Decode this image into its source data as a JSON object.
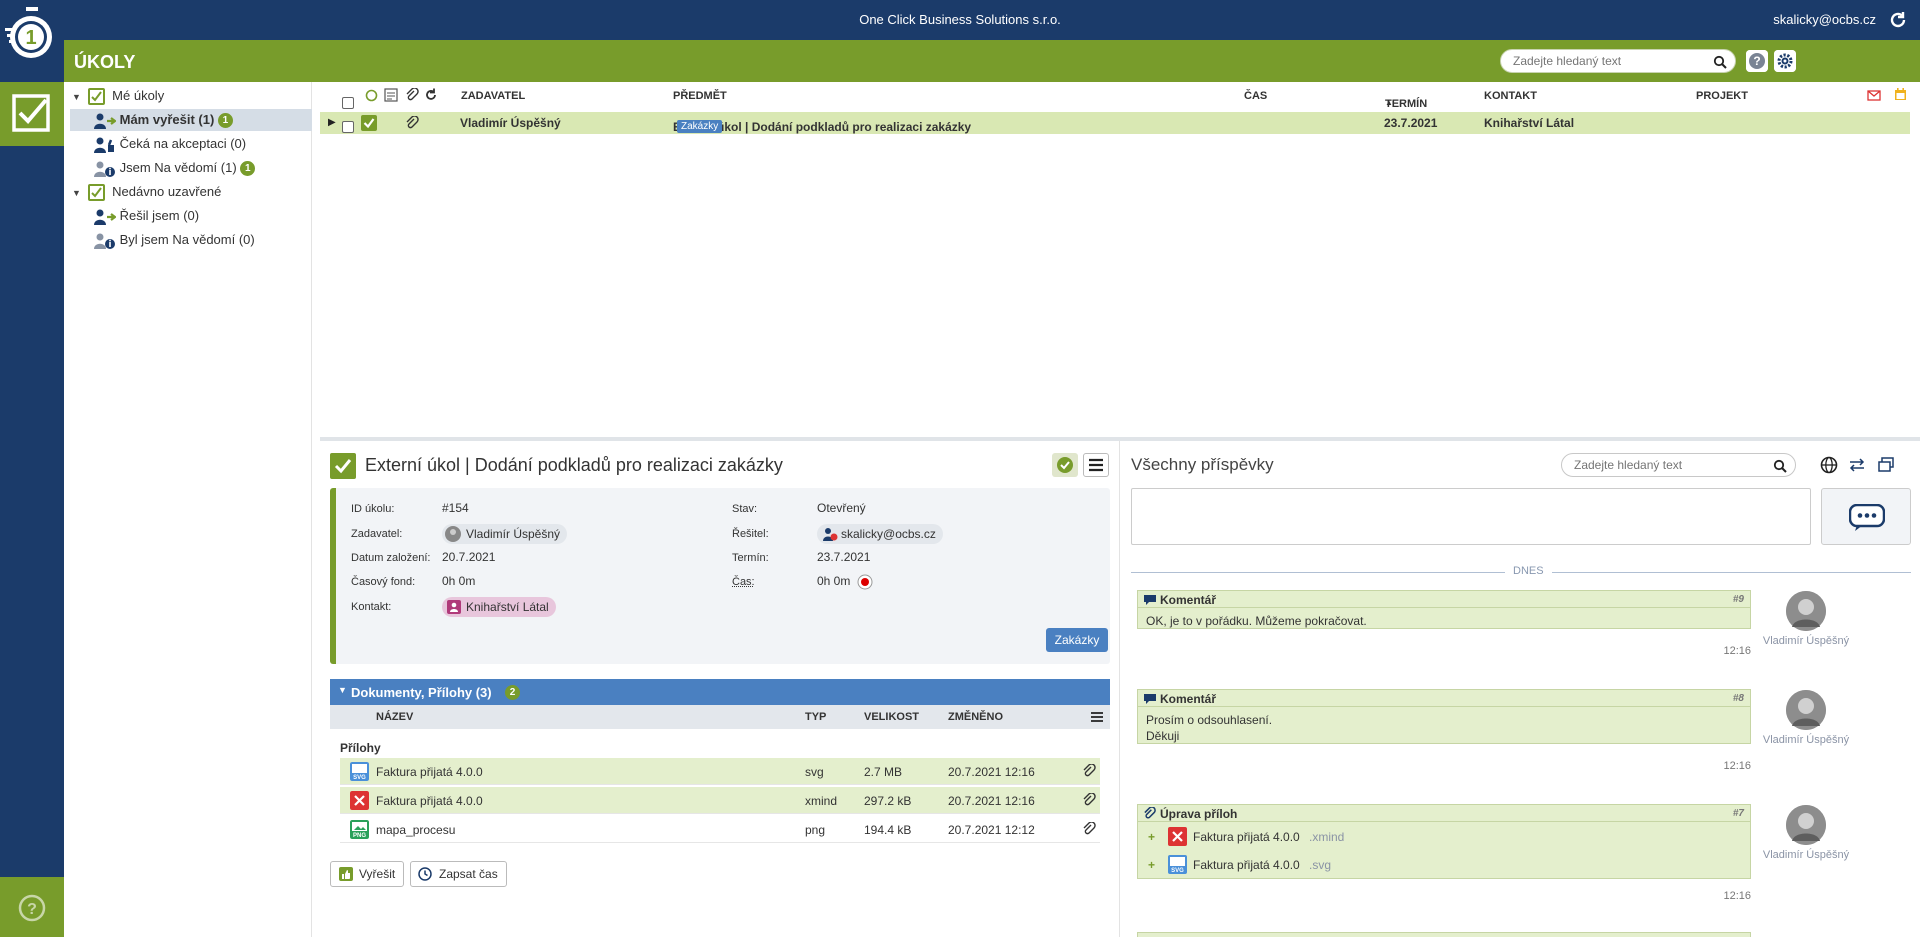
{
  "topbar": {
    "company": "One Click Business Solutions s.r.o.",
    "user": "skalicky@ocbs.cz"
  },
  "header": {
    "title": "ÚKOLY",
    "search_placeholder": "Zadejte hledaný text"
  },
  "sidebar": {
    "items": [
      {
        "label": "Mé úkoly"
      },
      {
        "label": "Mám vyřešit (1)",
        "badge": "1"
      },
      {
        "label": "Čeká na akceptaci (0)"
      },
      {
        "label": "Jsem Na vědomí (1)",
        "badge": "1"
      },
      {
        "label": "Nedávno uzavřené"
      },
      {
        "label": "Řešil jsem (0)"
      },
      {
        "label": "Byl jsem Na vědomí (0)"
      }
    ]
  },
  "grid": {
    "columns": {
      "zadavatel": "ZADAVATEL",
      "predmet": "PŘEDMĚT",
      "cas": "ČAS",
      "termin": "TERMÍN",
      "kontakt": "KONTAKT",
      "projekt": "PROJEKT"
    },
    "rows": [
      {
        "zadavatel": "Vladimír Úspěšný",
        "predmet": "Externí úkol | Dodání podkladů pro realizaci zakázky",
        "tag": "Zakázky",
        "termin": "23.7.2021",
        "kontakt": "Knihařství Látal"
      }
    ]
  },
  "detail": {
    "title": "Externí úkol | Dodání podkladů pro realizaci zakázky",
    "labels": {
      "id": "ID úkolu:",
      "zadavatel": "Zadavatel:",
      "datum": "Datum založení:",
      "fond": "Časový fond:",
      "kontakt": "Kontakt:",
      "stav": "Stav:",
      "resitel": "Řešitel:",
      "termin": "Termín:",
      "cas": "Čas:"
    },
    "values": {
      "id": "#154",
      "zadavatel": "Vladimír Úspěšný",
      "datum": "20.7.2021",
      "fond": "0h 0m",
      "kontakt": "Knihařství Látal",
      "stav": "Otevřený",
      "resitel": "skalicky@ocbs.cz",
      "termin": "23.7.2021",
      "cas": "0h 0m"
    },
    "tag_button": "Zakázky",
    "documents": {
      "header": "Dokumenty, Přílohy (3)",
      "badge": "2",
      "columns": {
        "nazev": "NÁZEV",
        "typ": "TYP",
        "velikost": "VELIKOST",
        "zmeneno": "ZMĚNĚNO"
      },
      "group": "Přílohy",
      "rows": [
        {
          "name": "Faktura přijatá 4.0.0",
          "type": "svg",
          "size": "2.7 MB",
          "changed": "20.7.2021 12:16",
          "icon": "svg-file-icon"
        },
        {
          "name": "Faktura přijatá 4.0.0",
          "type": "xmind",
          "size": "297.2 kB",
          "changed": "20.7.2021 12:16",
          "icon": "xmind-file-icon"
        },
        {
          "name": "mapa_procesu",
          "type": "png",
          "size": "194.4 kB",
          "changed": "20.7.2021 12:12",
          "icon": "png-file-icon"
        }
      ]
    },
    "actions": {
      "resolve": "Vyřešit",
      "log_time": "Zapsat čas"
    }
  },
  "posts": {
    "title": "Všechny příspěvky",
    "search_placeholder": "Zadejte hledaný text",
    "today": "DNES",
    "items": [
      {
        "type": "Komentář",
        "num": "#9",
        "lines": [
          "OK, je to v pořádku. Můžeme pokračovat."
        ],
        "time": "12:16",
        "author": "Vladimír Úspěšný"
      },
      {
        "type": "Komentář",
        "num": "#8",
        "lines": [
          "Prosím o odsouhlasení.",
          "Děkuji"
        ],
        "time": "12:16",
        "author": "Vladimír Úspěšný"
      },
      {
        "type": "Úprava příloh",
        "num": "#7",
        "files": [
          {
            "name": "Faktura přijatá 4.0.0",
            "ext": ".xmind"
          },
          {
            "name": "Faktura přijatá 4.0.0",
            "ext": ".svg"
          }
        ],
        "time": "12:16",
        "author": "Vladimír Úspěšný"
      }
    ]
  },
  "colors": {
    "navy": "#1b3b6a",
    "green": "#789c2b",
    "blue": "#4a80c1",
    "row_highlight": "#d9e8b3"
  }
}
